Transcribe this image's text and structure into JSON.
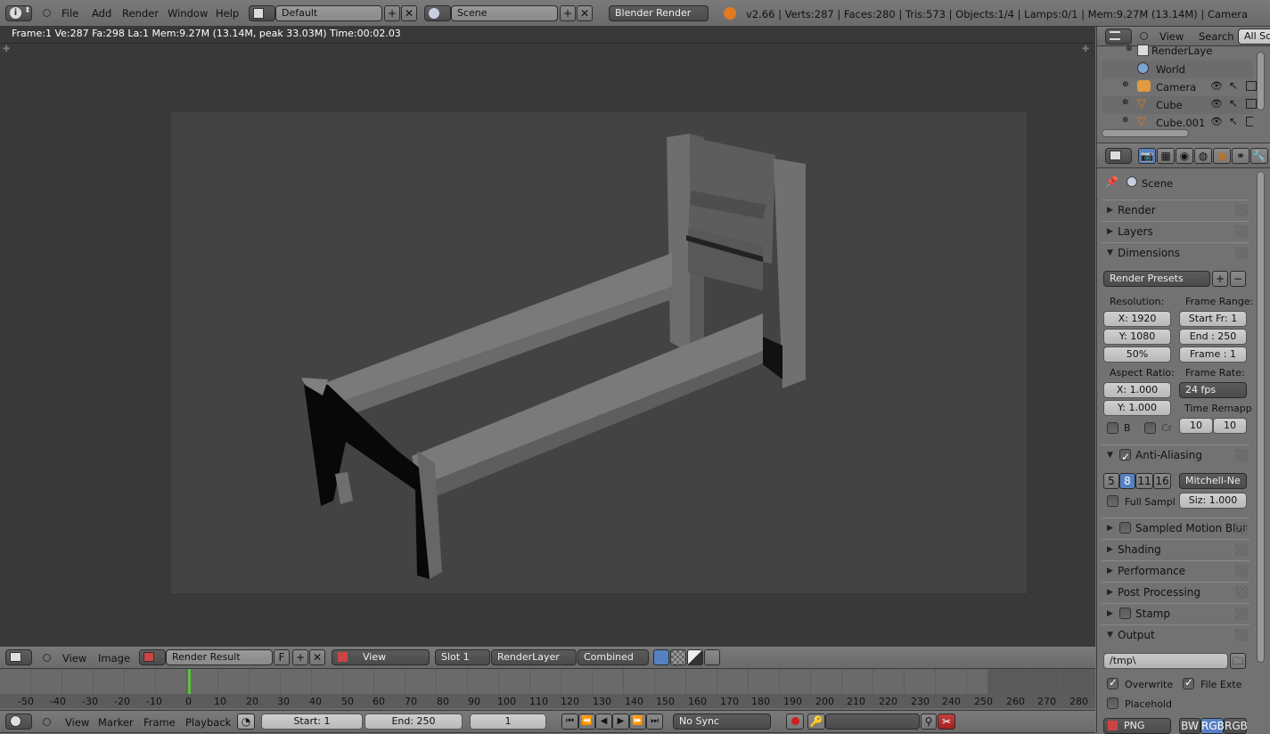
{
  "top_header": {
    "menus": [
      "File",
      "Add",
      "Render",
      "Window",
      "Help"
    ],
    "layout_name": "Default",
    "scene_name": "Scene",
    "engine": "Blender Render",
    "stats": "v2.66 | Verts:287 | Faces:280 | Tris:573 | Objects:1/4 | Lamps:0/1 | Mem:9.27M (13.14M) | Camera"
  },
  "image_editor": {
    "info_line": "Frame:1 Ve:287 Fa:298 La:1 Mem:9.27M (13.14M, peak 33.03M) Time:00:02.03",
    "header": {
      "menus": [
        "View",
        "Image"
      ],
      "image_name": "Render Result",
      "fake_user": "F",
      "view_mode": "View",
      "slot": "Slot 1",
      "layer": "RenderLayer",
      "pass": "Combined"
    }
  },
  "timeline": {
    "ticks": [
      "-50",
      "-40",
      "-30",
      "-20",
      "-10",
      "0",
      "10",
      "20",
      "30",
      "40",
      "50",
      "60",
      "70",
      "80",
      "90",
      "100",
      "110",
      "120",
      "130",
      "140",
      "150",
      "160",
      "170",
      "180",
      "190",
      "200",
      "210",
      "220",
      "230",
      "240",
      "250",
      "260",
      "270",
      "280"
    ],
    "menus": [
      "View",
      "Marker",
      "Frame",
      "Playback"
    ],
    "start": "Start: 1",
    "end": "End: 250",
    "current": "1",
    "sync": "No Sync"
  },
  "outliner": {
    "menus": [
      "View",
      "Search"
    ],
    "filter": "All Sc",
    "items": [
      "RenderLaye",
      "World",
      "Camera",
      "Cube",
      "Cube.001"
    ]
  },
  "properties": {
    "context": "Scene",
    "panels": {
      "render": "Render",
      "layers": "Layers",
      "dimensions": "Dimensions",
      "anti_aliasing": "Anti-Aliasing",
      "motion_blur": "Sampled Motion Blur",
      "shading": "Shading",
      "performance": "Performance",
      "post_processing": "Post Processing",
      "stamp": "Stamp",
      "output": "Output"
    },
    "dimensions": {
      "presets": "Render Presets",
      "resolution_label": "Resolution:",
      "res_x": "X: 1920",
      "res_y": "Y: 1080",
      "res_pct": "50%",
      "frame_range_label": "Frame Range:",
      "start_fr": "Start Fr: 1",
      "end": "End : 250",
      "frame": "Frame : 1",
      "aspect_label": "Aspect Ratio:",
      "asp_x": "X: 1.000",
      "asp_y": "Y: 1.000",
      "frame_rate_label": "Frame Rate:",
      "fps": "24 fps",
      "time_remap_label": "Time Remapp",
      "remap_old": "10",
      "remap_new": "10",
      "border": "B",
      "crop": "Cr"
    },
    "aa": {
      "samples": [
        "5",
        "8",
        "11",
        "16"
      ],
      "selected": "8",
      "filter": "Mitchell-Ne",
      "full_sample": "Full Sampl",
      "size": "Siz: 1.000"
    },
    "output": {
      "path": "/tmp\\",
      "overwrite": "Overwrite",
      "file_ext": "File Exte",
      "placeholders": "Placehold",
      "format": "PNG",
      "color_modes": [
        "BW",
        "RGB",
        "RGB"
      ]
    }
  },
  "colors": {
    "viewport_bg": "#393939",
    "render_bg": "#434343",
    "panel_bg": "#727272",
    "accent_blue": "#5680c2",
    "frame_marker": "#60c040"
  }
}
